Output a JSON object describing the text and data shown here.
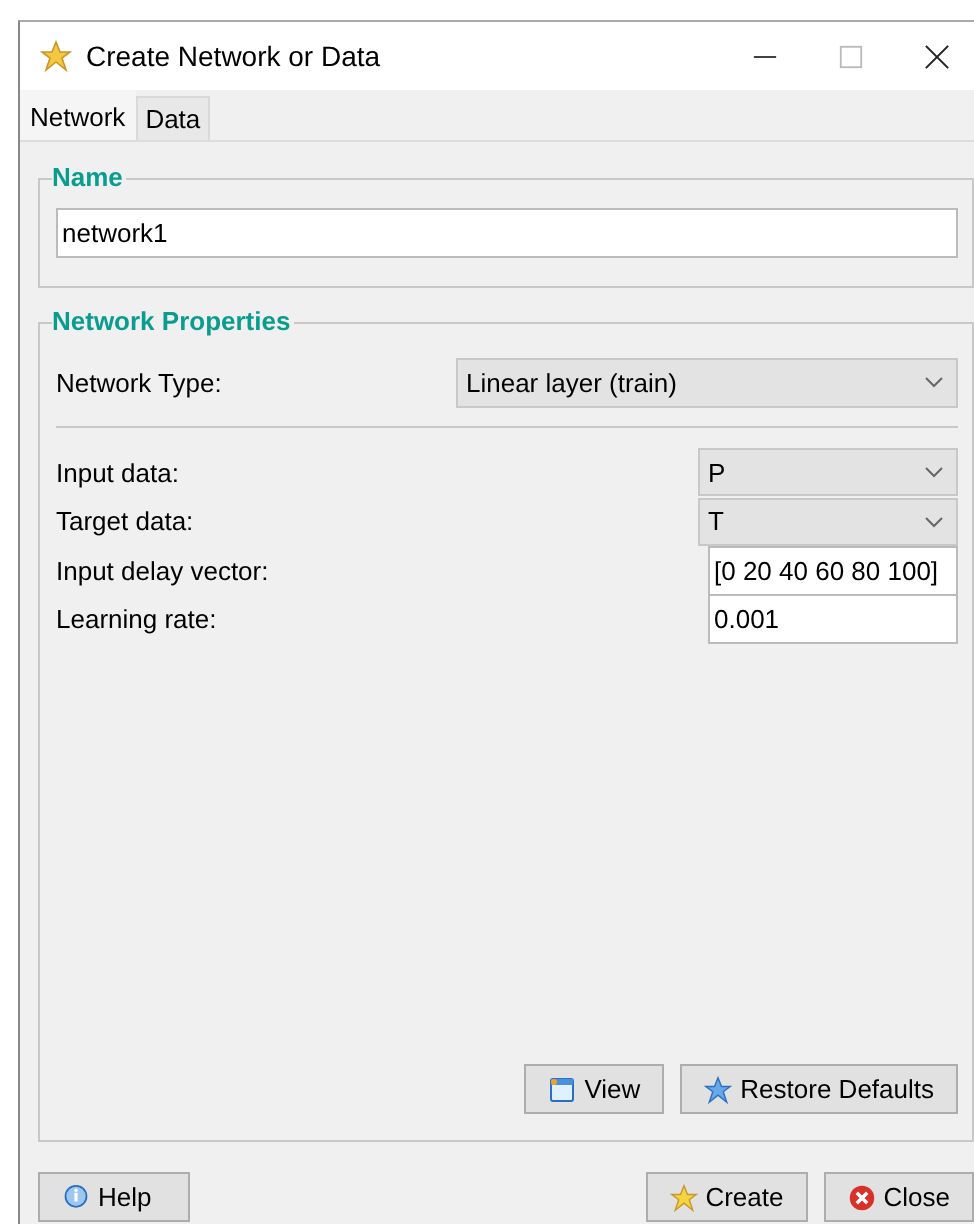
{
  "window": {
    "title": "Create Network or Data"
  },
  "tabs": [
    {
      "label": "Network",
      "selected": true
    },
    {
      "label": "Data",
      "selected": false
    }
  ],
  "name_group": {
    "title": "Name",
    "value": "network1"
  },
  "properties": {
    "title": "Network Properties",
    "network_type": {
      "label": "Network Type:",
      "value": "Linear layer (train)"
    },
    "params": [
      {
        "kind": "select",
        "label": "Input data:",
        "value": "P"
      },
      {
        "kind": "select",
        "label": "Target data:",
        "value": "T"
      },
      {
        "kind": "input",
        "label": "Input delay vector:",
        "value": "[0 20 40 60 80 100]"
      },
      {
        "kind": "input",
        "label": "Learning rate:",
        "value": "0.001"
      }
    ],
    "buttons": [
      {
        "kind": "view",
        "label": "View"
      },
      {
        "kind": "restore",
        "label": "Restore Defaults"
      }
    ]
  },
  "footer": {
    "left": [
      {
        "kind": "help",
        "label": "Help"
      }
    ],
    "right": [
      {
        "kind": "create",
        "label": "Create"
      },
      {
        "kind": "close",
        "label": "Close"
      }
    ]
  }
}
